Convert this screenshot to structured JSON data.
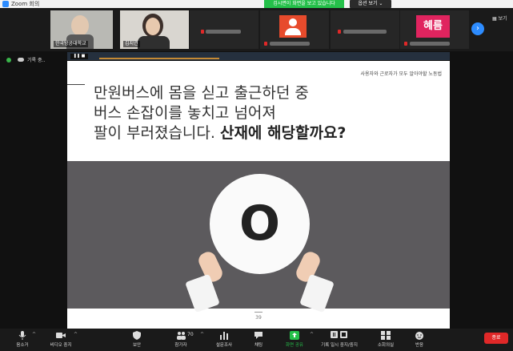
{
  "window": {
    "title": "Zoom 회의"
  },
  "share_banner": {
    "text": "검시면이 화면을 보고 있습니다",
    "view_options": "옵션 보기 ⌄"
  },
  "gallery": {
    "tiles": [
      {
        "name": "한국방공대학교"
      },
      {
        "name": "김지연"
      },
      {
        "name": ""
      },
      {
        "name": ""
      },
      {
        "name": ""
      },
      {
        "name": "",
        "avatar_text": "혜름"
      }
    ],
    "view_label": "▦ 보기"
  },
  "recording": {
    "label": "기록 중.."
  },
  "share_control": {
    "pause": "❚❚ ■"
  },
  "slide": {
    "tag": "사용자와 근로자가 모두 알아야할 노동법",
    "line1": "만원버스에 몸을 싣고 출근하던 중",
    "line2": "버스 손잡이를 놓치고 넘어져",
    "line3_a": "팔이 부러졌습니다. ",
    "line3_b": "산재에 해당할까요?",
    "sign_text": "O",
    "page_number": "39"
  },
  "toolbar": {
    "mute": "음소거",
    "video": "비디오 중지",
    "security": "보안",
    "participants": "참가자",
    "participants_count": "70",
    "polls": "설문조사",
    "chat": "채팅",
    "share": "화면 공유",
    "record": "기록 일시 중지/중지",
    "breakout": "소회의실",
    "reactions": "반응",
    "end": "종료"
  },
  "colors": {
    "accent_blue": "#2d8cff",
    "share_green": "#25c04a",
    "end_red": "#e02828",
    "slide_stripe": "#c58a35"
  }
}
